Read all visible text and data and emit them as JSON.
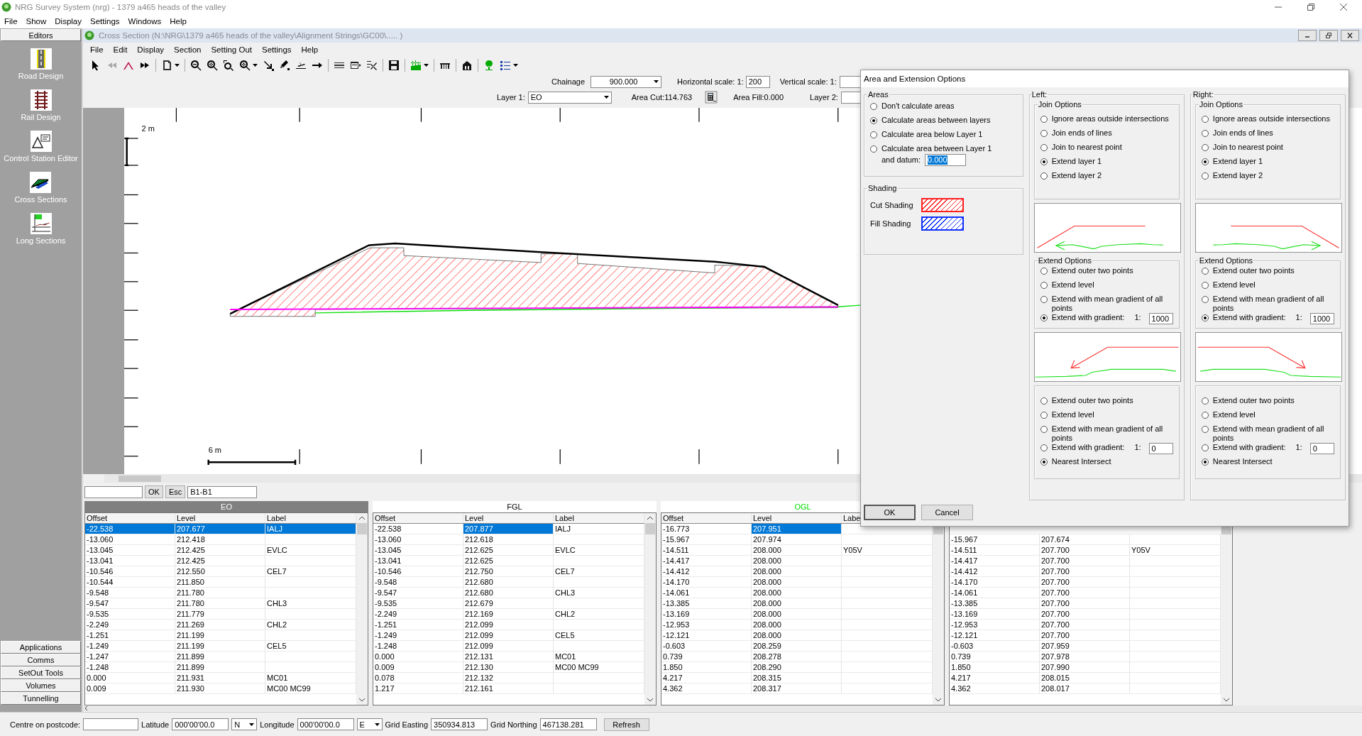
{
  "window": {
    "title": "NRG Survey System (nrg) - 1379 a465 heads of the valley"
  },
  "menu": [
    "File",
    "Show",
    "Display",
    "Settings",
    "Windows",
    "Help"
  ],
  "sidebar": {
    "header": "Editors",
    "items": [
      {
        "label": "Road Design",
        "kind": "road"
      },
      {
        "label": "Rail Design",
        "kind": "rail"
      },
      {
        "label": "Control Station Editor",
        "kind": "station"
      },
      {
        "label": "Cross Sections",
        "kind": "cross"
      },
      {
        "label": "Long Sections",
        "kind": "long"
      }
    ],
    "buttons": [
      "Applications",
      "Comms",
      "SetOut Tools",
      "Volumes",
      "Tunnelling"
    ]
  },
  "child_window": {
    "title": "Cross Section  (N:\\NRG\\1379 a465 heads of the valley\\Alignment Strings\\GC00\\..... )",
    "menu": [
      "File",
      "Edit",
      "Display",
      "Section",
      "Setting Out",
      "Settings",
      "Help"
    ]
  },
  "section_bar": {
    "chainage_label": "Chainage",
    "chainage": "900.000",
    "horizontal_scale_label": "Horizontal scale: 1:",
    "horizontal_scale": "200",
    "vertical_scale_label": "Vertical scale: 1:",
    "layer_1_label": "Layer 1:",
    "layer_1": "EO",
    "area_cut": "Area Cut:114.763",
    "area_fill": "Area Fill:0.000",
    "layer_2_label": "Layer 2:"
  },
  "canvas": {
    "vertical_scale_bar": "2 m",
    "horizontal_scale_bar": "6 m"
  },
  "command_bar": {
    "ok": "OK",
    "esc": "Esc",
    "range": "B1-B1"
  },
  "tables": [
    {
      "title": "EO",
      "selected": true,
      "columns": [
        "Offset",
        "Level",
        "Label"
      ],
      "rows": [
        {
          "cells": [
            "-22.538",
            "207.677",
            "IALJ"
          ],
          "selected": true
        },
        {
          "cells": [
            "-13.060",
            "212.418",
            ""
          ],
          "selected": false
        },
        {
          "cells": [
            "-13.045",
            "212.425",
            "EVLC"
          ],
          "selected": false
        },
        {
          "cells": [
            "-13.041",
            "212.425",
            ""
          ],
          "selected": false
        },
        {
          "cells": [
            "-10.546",
            "212.550",
            "CEL7"
          ],
          "selected": false
        },
        {
          "cells": [
            "-10.544",
            "211.850",
            ""
          ],
          "selected": false
        },
        {
          "cells": [
            "-9.548",
            "211.780",
            ""
          ],
          "selected": false
        },
        {
          "cells": [
            "-9.547",
            "211.780",
            "CHL3"
          ],
          "selected": false
        },
        {
          "cells": [
            "-9.535",
            "211.779",
            ""
          ],
          "selected": false
        },
        {
          "cells": [
            "-2.249",
            "211.269",
            "CHL2"
          ],
          "selected": false
        },
        {
          "cells": [
            "-1.251",
            "211.199",
            ""
          ],
          "selected": false
        },
        {
          "cells": [
            "-1.249",
            "211.199",
            "CEL5"
          ],
          "selected": false
        },
        {
          "cells": [
            "-1.247",
            "211.899",
            ""
          ],
          "selected": false
        },
        {
          "cells": [
            "-1.248",
            "211.899",
            ""
          ],
          "selected": false
        },
        {
          "cells": [
            "0.000",
            "211.931",
            "MC01"
          ],
          "selected": false
        },
        {
          "cells": [
            "0.009",
            "211.930",
            "MC00 MC99"
          ],
          "selected": false
        }
      ]
    },
    {
      "title": "FGL",
      "selected": false,
      "columns": [
        "Offset",
        "Level",
        "Label"
      ],
      "rows": [
        {
          "cells": [
            "-22.538",
            "207.877",
            "IALJ"
          ],
          "selected": true
        },
        {
          "cells": [
            "-13.060",
            "212.618",
            ""
          ],
          "selected": false
        },
        {
          "cells": [
            "-13.045",
            "212.625",
            "EVLC"
          ],
          "selected": false
        },
        {
          "cells": [
            "-13.041",
            "212.625",
            ""
          ],
          "selected": false
        },
        {
          "cells": [
            "-10.546",
            "212.750",
            "CEL7"
          ],
          "selected": false
        },
        {
          "cells": [
            "-9.548",
            "212.680",
            ""
          ],
          "selected": false
        },
        {
          "cells": [
            "-9.547",
            "212.680",
            "CHL3"
          ],
          "selected": false
        },
        {
          "cells": [
            "-9.535",
            "212.679",
            ""
          ],
          "selected": false
        },
        {
          "cells": [
            "-2.249",
            "212.169",
            "CHL2"
          ],
          "selected": false
        },
        {
          "cells": [
            "-1.251",
            "212.099",
            ""
          ],
          "selected": false
        },
        {
          "cells": [
            "-1.249",
            "212.099",
            "CEL5"
          ],
          "selected": false
        },
        {
          "cells": [
            "-1.248",
            "212.099",
            ""
          ],
          "selected": false
        },
        {
          "cells": [
            "0.000",
            "212.131",
            "MC01"
          ],
          "selected": false
        },
        {
          "cells": [
            "0.009",
            "212.130",
            "MC00 MC99"
          ],
          "selected": false
        },
        {
          "cells": [
            "0.078",
            "212.132",
            ""
          ],
          "selected": false
        },
        {
          "cells": [
            "1.217",
            "212.161",
            ""
          ],
          "selected": false
        }
      ]
    },
    {
      "title": "OGL",
      "selected": false,
      "color": "#00e000",
      "columns": [
        "Offset",
        "Level",
        "Labe"
      ],
      "rows": [
        {
          "cells": [
            "-16.773",
            "207.951",
            ""
          ],
          "selected": true
        },
        {
          "cells": [
            "-15.967",
            "207.974",
            ""
          ],
          "selected": false
        },
        {
          "cells": [
            "-14.511",
            "208.000",
            "Y05V"
          ],
          "selected": false
        },
        {
          "cells": [
            "-14.417",
            "208.000",
            ""
          ],
          "selected": false
        },
        {
          "cells": [
            "-14.412",
            "208.000",
            ""
          ],
          "selected": false
        },
        {
          "cells": [
            "-14.170",
            "208.000",
            ""
          ],
          "selected": false
        },
        {
          "cells": [
            "-14.061",
            "208.000",
            ""
          ],
          "selected": false
        },
        {
          "cells": [
            "-13.385",
            "208.000",
            ""
          ],
          "selected": false
        },
        {
          "cells": [
            "-13.169",
            "208.000",
            ""
          ],
          "selected": false
        },
        {
          "cells": [
            "-12.953",
            "208.000",
            ""
          ],
          "selected": false
        },
        {
          "cells": [
            "-12.121",
            "208.000",
            ""
          ],
          "selected": false
        },
        {
          "cells": [
            "-0.603",
            "208.259",
            ""
          ],
          "selected": false
        },
        {
          "cells": [
            "0.739",
            "208.278",
            ""
          ],
          "selected": false
        },
        {
          "cells": [
            "1.850",
            "208.290",
            ""
          ],
          "selected": false
        },
        {
          "cells": [
            "4.217",
            "208.315",
            ""
          ],
          "selected": false
        },
        {
          "cells": [
            "4.362",
            "208.317",
            ""
          ],
          "selected": false
        }
      ]
    },
    {
      "rows": [
        {
          "cells": [
            "-15.967",
            "207.674",
            ""
          ],
          "selected": false
        },
        {
          "cells": [
            "-14.511",
            "207.700",
            "Y05V"
          ],
          "selected": false
        },
        {
          "cells": [
            "-14.417",
            "207.700",
            ""
          ],
          "selected": false
        },
        {
          "cells": [
            "-14.412",
            "207.700",
            ""
          ],
          "selected": false
        },
        {
          "cells": [
            "-14.170",
            "207.700",
            ""
          ],
          "selected": false
        },
        {
          "cells": [
            "-14.061",
            "207.700",
            ""
          ],
          "selected": false
        },
        {
          "cells": [
            "-13.385",
            "207.700",
            ""
          ],
          "selected": false
        },
        {
          "cells": [
            "-13.169",
            "207.700",
            ""
          ],
          "selected": false
        },
        {
          "cells": [
            "-12.953",
            "207.700",
            ""
          ],
          "selected": false
        },
        {
          "cells": [
            "-12.121",
            "207.700",
            ""
          ],
          "selected": false
        },
        {
          "cells": [
            "-0.603",
            "207.959",
            ""
          ],
          "selected": false
        },
        {
          "cells": [
            "0.739",
            "207.978",
            ""
          ],
          "selected": false
        },
        {
          "cells": [
            "1.850",
            "207.990",
            ""
          ],
          "selected": false
        },
        {
          "cells": [
            "4.217",
            "208.015",
            ""
          ],
          "selected": false
        },
        {
          "cells": [
            "4.362",
            "208.017",
            ""
          ],
          "selected": false
        }
      ]
    }
  ],
  "dialog": {
    "title": "Area and Extension Options",
    "areas": {
      "title": "Areas",
      "options": [
        {
          "label": "Don't calculate areas",
          "selected": false,
          "kind": "plain"
        },
        {
          "label": "Calculate areas between layers",
          "selected": true,
          "kind": "plain"
        },
        {
          "label": "Calculate area below Layer 1",
          "selected": false,
          "kind": "plain"
        },
        {
          "label": "Calculate area between Layer 1",
          "selected": false,
          "kind": "datum",
          "datum_label": "and datum:",
          "value": "0.000"
        }
      ]
    },
    "shading": {
      "title": "Shading",
      "items": [
        {
          "label": "Cut Shading",
          "color": "#ff2020"
        },
        {
          "label": "Fill Shading",
          "color": "#1030ff"
        }
      ]
    },
    "sides": [
      {
        "title": "Left:",
        "kind": "left",
        "join": {
          "title": "Join Options",
          "options": [
            {
              "label": "Ignore areas outside intersections",
              "selected": false,
              "kind": "plain"
            },
            {
              "label": "Join ends of lines",
              "selected": false,
              "kind": "plain"
            },
            {
              "label": "Join to nearest point",
              "selected": false,
              "kind": "plain"
            },
            {
              "label": "Extend layer 1",
              "selected": true,
              "kind": "plain"
            },
            {
              "label": "Extend layer 2",
              "selected": false,
              "kind": "plain"
            }
          ]
        },
        "extend": {
          "title": "Extend Options",
          "options": [
            {
              "label": "Extend outer two points",
              "selected": false,
              "kind": "plain"
            },
            {
              "label": "Extend level",
              "selected": false,
              "kind": "plain"
            },
            {
              "label": "Extend with mean gradient of all points",
              "selected": false,
              "kind": "plain"
            },
            {
              "label": "Extend with gradient:",
              "selected": true,
              "kind": "gradient",
              "ratio": "1:",
              "value": "1000"
            }
          ]
        },
        "intersect": {
          "options": [
            {
              "label": "Extend outer two points",
              "selected": false,
              "kind": "plain"
            },
            {
              "label": "Extend level",
              "selected": false,
              "kind": "plain"
            },
            {
              "label": "Extend with mean gradient of all points",
              "selected": false,
              "kind": "plain"
            },
            {
              "label": "Extend with gradient:",
              "selected": false,
              "kind": "gradient",
              "ratio": "1:",
              "value": "0"
            },
            {
              "label": "Nearest Intersect",
              "selected": true,
              "kind": "plain"
            }
          ]
        }
      },
      {
        "title": "Right:",
        "kind": "right",
        "join": {
          "title": "Join Options",
          "options": [
            {
              "label": "Ignore areas outside intersections",
              "selected": false,
              "kind": "plain"
            },
            {
              "label": "Join ends of lines",
              "selected": false,
              "kind": "plain"
            },
            {
              "label": "Join to nearest point",
              "selected": false,
              "kind": "plain"
            },
            {
              "label": "Extend layer 1",
              "selected": true,
              "kind": "plain"
            },
            {
              "label": "Extend layer 2",
              "selected": false,
              "kind": "plain"
            }
          ]
        },
        "extend": {
          "title": "Extend Options",
          "options": [
            {
              "label": "Extend outer two points",
              "selected": false,
              "kind": "plain"
            },
            {
              "label": "Extend level",
              "selected": false,
              "kind": "plain"
            },
            {
              "label": "Extend with mean gradient of all points",
              "selected": false,
              "kind": "plain"
            },
            {
              "label": "Extend with gradient:",
              "selected": true,
              "kind": "gradient",
              "ratio": "1:",
              "value": "1000"
            }
          ]
        },
        "intersect": {
          "options": [
            {
              "label": "Extend outer two points",
              "selected": false,
              "kind": "plain"
            },
            {
              "label": "Extend level",
              "selected": false,
              "kind": "plain"
            },
            {
              "label": "Extend with mean gradient of all points",
              "selected": false,
              "kind": "plain"
            },
            {
              "label": "Extend with gradient:",
              "selected": false,
              "kind": "gradient",
              "ratio": "1:",
              "value": "0"
            },
            {
              "label": "Nearest Intersect",
              "selected": true,
              "kind": "plain"
            }
          ]
        }
      }
    ],
    "buttons": [
      "OK",
      "Cancel"
    ]
  },
  "status_bar": {
    "postcode_label": "Centre on postcode:",
    "latitude_label": "Latitude",
    "latitude": "000'00'00.0",
    "latitude_hemisphere": "N",
    "longitude_label": "Longitude",
    "longitude": "000'00'00.0",
    "longitude_hemisphere": "E",
    "easting_label": "Grid Easting",
    "easting": "350934.813",
    "northing_label": "Grid Northing",
    "northing": "467138.281",
    "refresh": "Refresh"
  }
}
